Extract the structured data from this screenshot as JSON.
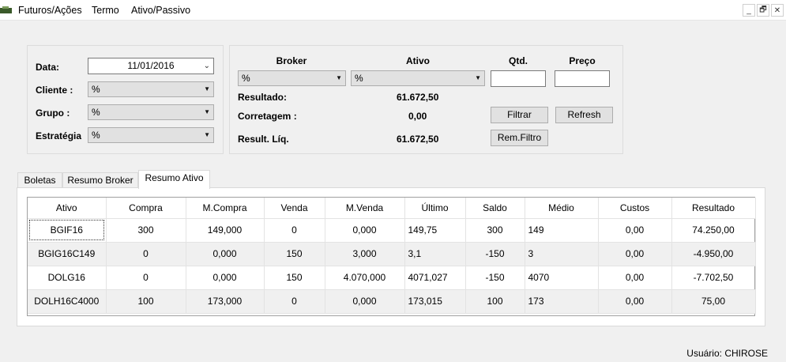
{
  "menu": {
    "items": [
      "Futuros/Ações",
      "Termo",
      "Ativo/Passivo"
    ],
    "window_controls": [
      "_",
      "🗗",
      "✕"
    ]
  },
  "filters": {
    "data_label": "Data:",
    "data_value": "11/01/2016",
    "cliente_label": "Cliente :",
    "cliente_value": "%",
    "grupo_label": "Grupo :",
    "grupo_value": "%",
    "estrategia_label": "Estratégia",
    "estrategia_value": "%"
  },
  "summary": {
    "broker_label": "Broker",
    "ativo_label": "Ativo",
    "qtd_label": "Qtd.",
    "preco_label": "Preço",
    "broker_value": "%",
    "ativo_value": "%",
    "qtd_value": "",
    "preco_value": "",
    "resultado_label": "Resultado:",
    "resultado_value": "61.672,50",
    "corretagem_label": "Corretagem :",
    "corretagem_value": "0,00",
    "result_liq_label": "Result. Líq.",
    "result_liq_value": "61.672,50",
    "filtrar_button": "Filtrar",
    "refresh_button": "Refresh",
    "rem_filtro_button": "Rem.Filtro"
  },
  "tabs": [
    "Boletas",
    "Resumo Broker",
    "Resumo Ativo"
  ],
  "active_tab": "Resumo Ativo",
  "grid": {
    "columns": [
      "Ativo",
      "Compra",
      "M.Compra",
      "Venda",
      "M.Venda",
      "Último",
      "Saldo",
      "Médio",
      "Custos",
      "Resultado"
    ],
    "rows": [
      [
        "BGIF16",
        "300",
        "149,000",
        "0",
        "0,000",
        "149,75",
        "300",
        "149",
        "0,00",
        "74.250,00"
      ],
      [
        "BGIG16C149",
        "0",
        "0,000",
        "150",
        "3,000",
        "3,1",
        "-150",
        "3",
        "0,00",
        "-4.950,00"
      ],
      [
        "DOLG16",
        "0",
        "0,000",
        "150",
        "4.070,000",
        "4071,027",
        "-150",
        "4070",
        "0,00",
        "-7.702,50"
      ],
      [
        "DOLH16C4000",
        "100",
        "173,000",
        "0",
        "0,000",
        "173,015",
        "100",
        "173",
        "0,00",
        "75,00"
      ]
    ]
  },
  "status": {
    "user": "Usuário: CHIROSE"
  }
}
